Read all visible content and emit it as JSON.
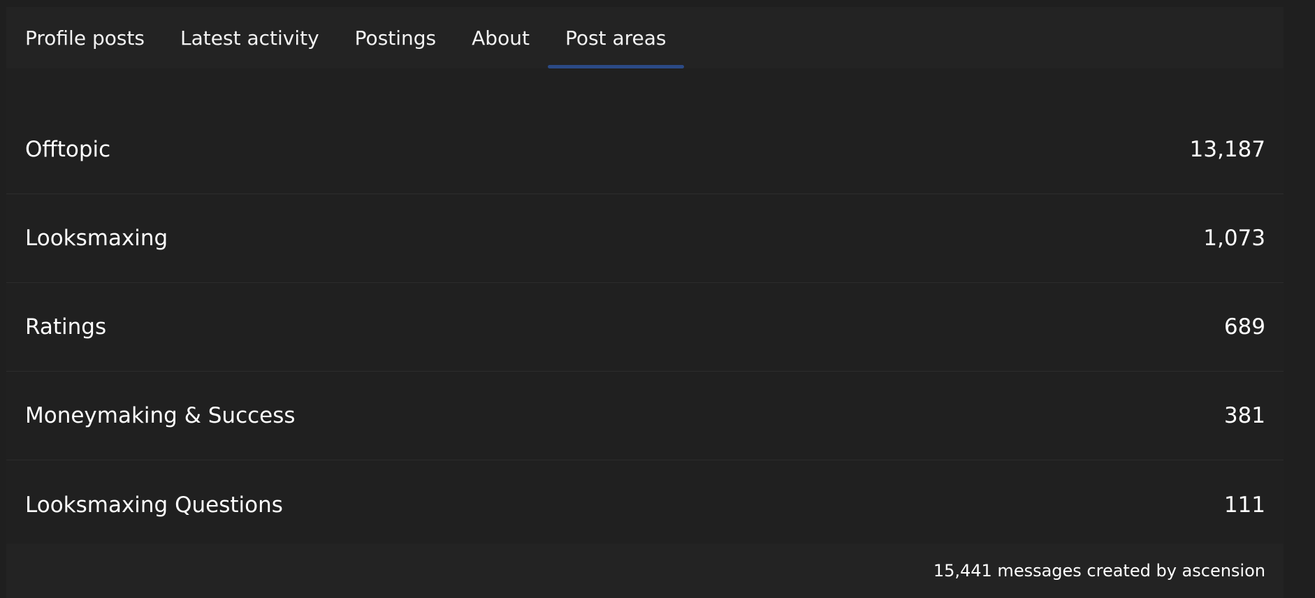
{
  "colors": {
    "background": "#1f1f1f",
    "tab_bar": "#232323",
    "accent": "#2b4a86",
    "divider": "#2c2c2c",
    "text": "#ffffff"
  },
  "tabs": [
    {
      "label": "Profile posts",
      "active": false
    },
    {
      "label": "Latest activity",
      "active": false
    },
    {
      "label": "Postings",
      "active": false
    },
    {
      "label": "About",
      "active": false
    },
    {
      "label": "Post areas",
      "active": true
    }
  ],
  "post_areas": [
    {
      "name": "Offtopic",
      "count": "13,187"
    },
    {
      "name": "Looksmaxing",
      "count": "1,073"
    },
    {
      "name": "Ratings",
      "count": "689"
    },
    {
      "name": "Moneymaking & Success",
      "count": "381"
    },
    {
      "name": "Looksmaxing Questions",
      "count": "111"
    }
  ],
  "footer": {
    "summary": "15,441 messages created by ascension"
  }
}
